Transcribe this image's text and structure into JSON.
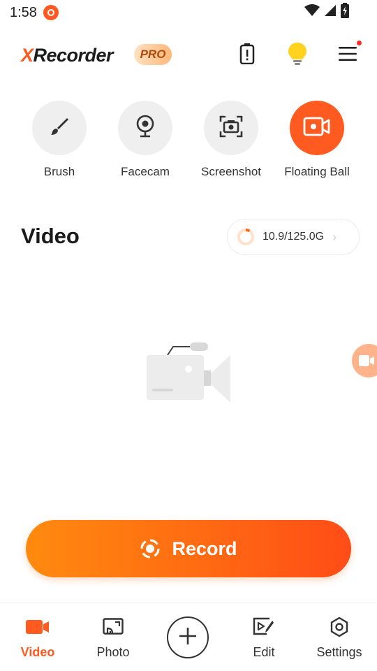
{
  "status_bar": {
    "time": "1:58"
  },
  "header": {
    "logo_x": "X",
    "logo_rest": "Recorder",
    "pro_badge": "PRO",
    "icons": [
      "battery-alert-icon",
      "lightbulb-icon",
      "menu-icon"
    ]
  },
  "tools": [
    {
      "label": "Brush",
      "icon": "brush-icon"
    },
    {
      "label": "Facecam",
      "icon": "webcam-icon"
    },
    {
      "label": "Screenshot",
      "icon": "camera-icon"
    },
    {
      "label": "Floating Ball",
      "icon": "video-camera-icon"
    }
  ],
  "video_section": {
    "title": "Video",
    "storage_text": "10.9/125.0G",
    "storage_used_fraction": 0.087
  },
  "record_button": {
    "label": "Record"
  },
  "bottom_nav": [
    {
      "label": "Video",
      "active": true
    },
    {
      "label": "Photo",
      "active": false
    },
    {
      "label": "Edit",
      "active": false
    },
    {
      "label": "Settings",
      "active": false
    }
  ],
  "colors": {
    "accent": "#ff5a1f",
    "record_gradient_start": "#ff8a0f",
    "record_gradient_end": "#ff4c17",
    "tool_bg": "#efefef"
  }
}
